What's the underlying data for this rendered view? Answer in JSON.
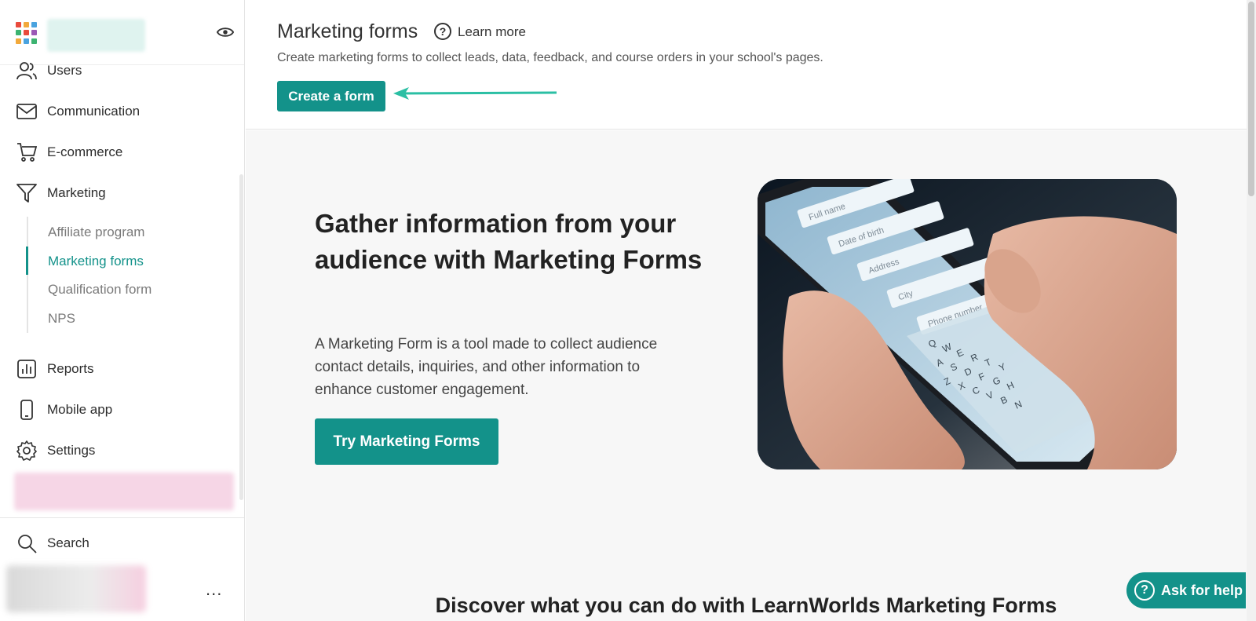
{
  "app": {
    "grid_colors": [
      "#e94b3c",
      "#f2a93b",
      "#4aa3df",
      "#3cb371",
      "#e94b3c",
      "#9b59b6",
      "#f2a93b",
      "#4aa3df",
      "#3cb371"
    ],
    "accent": "#13928a"
  },
  "sidebar": {
    "items": [
      {
        "label": "Users",
        "icon": "users-icon"
      },
      {
        "label": "Communication",
        "icon": "mail-icon"
      },
      {
        "label": "E-commerce",
        "icon": "cart-icon"
      },
      {
        "label": "Marketing",
        "icon": "funnel-icon"
      },
      {
        "label": "Reports",
        "icon": "bar-chart-icon"
      },
      {
        "label": "Mobile app",
        "icon": "phone-icon"
      },
      {
        "label": "Settings",
        "icon": "gear-icon"
      }
    ],
    "marketing_sub": [
      "Affiliate program",
      "Marketing forms",
      "Qualification form",
      "NPS"
    ],
    "active_sub": "Marketing forms",
    "search_label": "Search",
    "more_label": "..."
  },
  "header": {
    "title": "Marketing forms",
    "help_icon": "?",
    "learn_more": "Learn more",
    "subtitle": "Create marketing forms to collect leads, data, feedback, and course orders in your school's pages.",
    "create_button": "Create a form"
  },
  "hero": {
    "title": "Gather information from your audience with Marketing Forms",
    "description": "A Marketing Form is a tool made to collect audience contact details, inquiries, and other information to enhance customer engagement.",
    "button": "Try Marketing Forms",
    "image_fields": [
      "Full name",
      "Date of birth",
      "Address",
      "City",
      "Phone number"
    ],
    "keyboard_rows": [
      "QWERTY",
      "ASDFGH",
      "ZXCVBN"
    ]
  },
  "discover": "Discover what you can do with LearnWorlds Marketing Forms",
  "help_widget": {
    "label": "Ask for help",
    "icon": "?"
  }
}
